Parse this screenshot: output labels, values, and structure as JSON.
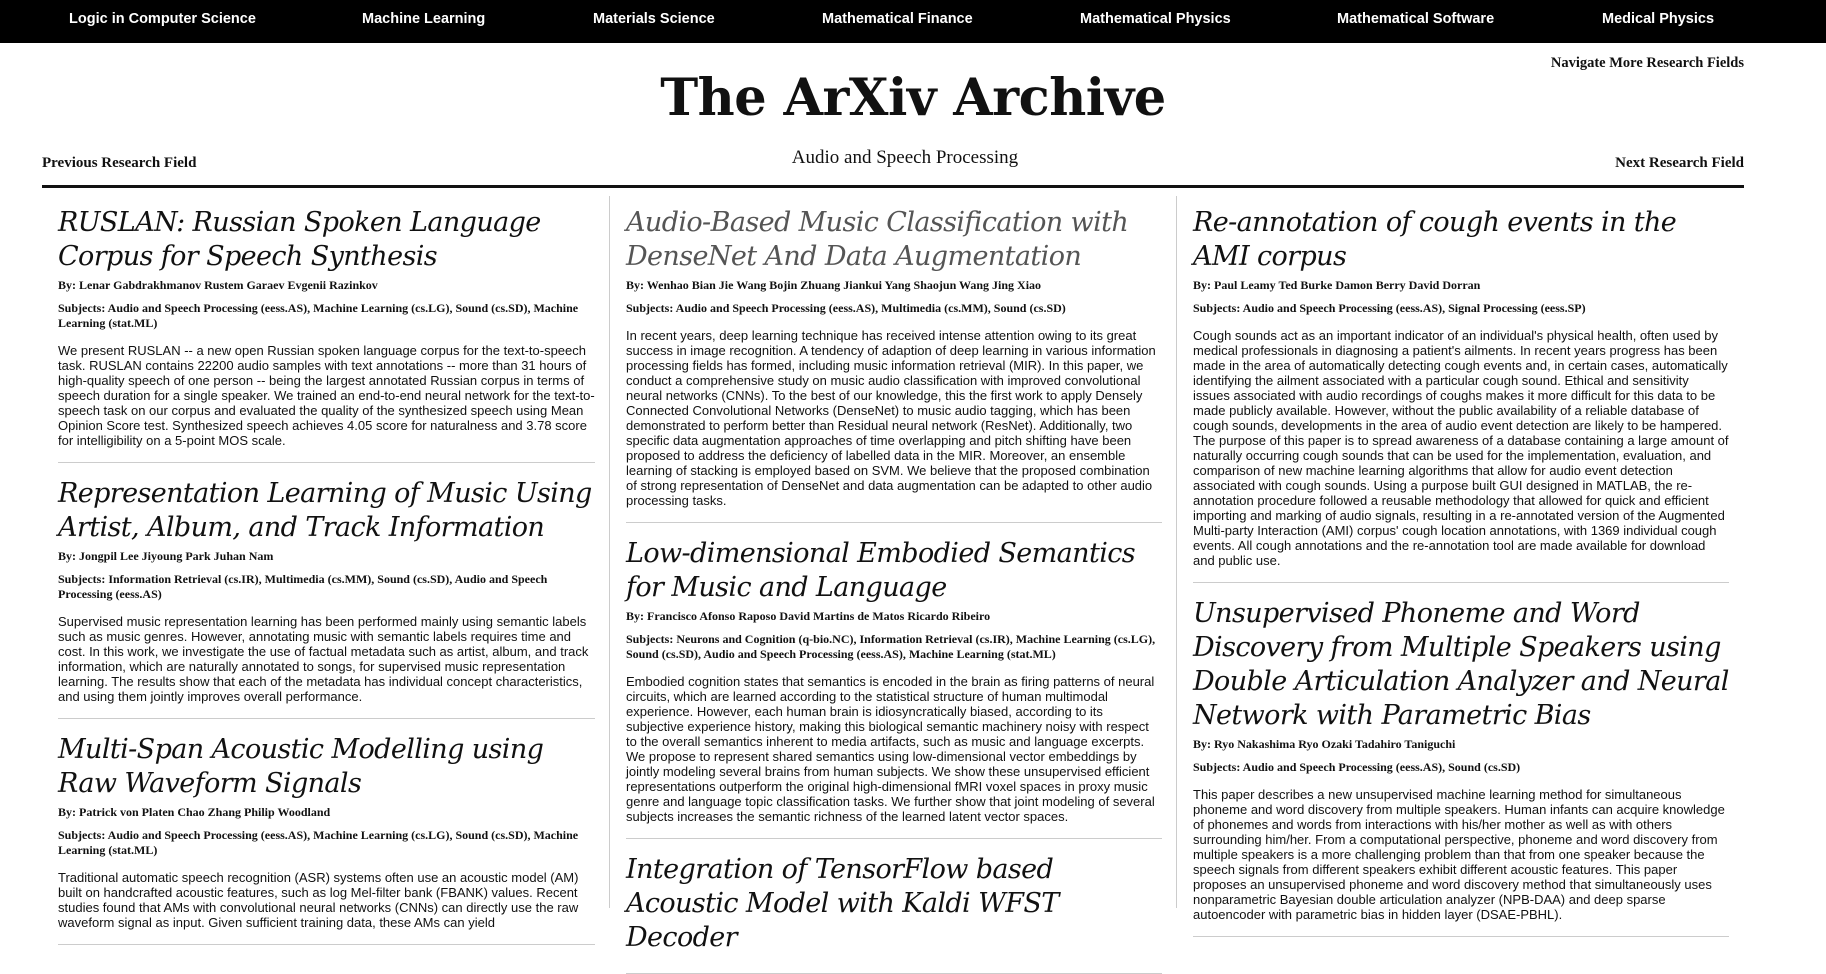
{
  "topnav": [
    {
      "label": "Logic in Computer Science"
    },
    {
      "label": "Machine Learning"
    },
    {
      "label": "Materials Science"
    },
    {
      "label": "Mathematical Finance"
    },
    {
      "label": "Mathematical Physics"
    },
    {
      "label": "Mathematical Software"
    },
    {
      "label": "Medical Physics"
    }
  ],
  "header": {
    "nav_more": "Navigate More Research Fields",
    "site_title": "The ArXiv Archive",
    "field_name": "Audio and Speech Processing",
    "prev_field": "Previous Research Field",
    "next_field": "Next Research Field"
  },
  "columns": [
    [
      {
        "title": "RUSLAN: Russian Spoken Language Corpus for Speech Synthesis",
        "authors": "By: Lenar Gabdrakhmanov Rustem Garaev Evgenii Razinkov",
        "subjects": "Subjects: Audio and Speech Processing (eess.AS), Machine Learning (cs.LG), Sound (cs.SD), Machine Learning (stat.ML)",
        "abstract": "We present RUSLAN -- a new open Russian spoken language corpus for the text-to-speech task. RUSLAN contains 22200 audio samples with text annotations -- more than 31 hours of high-quality speech of one person -- being the largest annotated Russian corpus in terms of speech duration for a single speaker. We trained an end-to-end neural network for the text-to-speech task on our corpus and evaluated the quality of the synthesized speech using Mean Opinion Score test. Synthesized speech achieves 4.05 score for naturalness and 3.78 score for intelligibility on a 5-point MOS scale."
      },
      {
        "title": "Representation Learning of Music Using Artist, Album, and Track Information",
        "authors": "By: Jongpil Lee Jiyoung Park Juhan Nam",
        "subjects": "Subjects: Information Retrieval (cs.IR), Multimedia (cs.MM), Sound (cs.SD), Audio and Speech Processing (eess.AS)",
        "abstract": "Supervised music representation learning has been performed mainly using semantic labels such as music genres. However, annotating music with semantic labels requires time and cost. In this work, we investigate the use of factual metadata such as artist, album, and track information, which are naturally annotated to songs, for supervised music representation learning. The results show that each of the metadata has individual concept characteristics, and using them jointly improves overall performance."
      },
      {
        "title": "Multi-Span Acoustic Modelling using Raw Waveform Signals",
        "authors": "By: Patrick von Platen Chao Zhang Philip Woodland",
        "subjects": "Subjects: Audio and Speech Processing (eess.AS), Machine Learning (cs.LG), Sound (cs.SD), Machine Learning (stat.ML)",
        "abstract": "Traditional automatic speech recognition (ASR) systems often use an acoustic model (AM) built on handcrafted acoustic features, such as log Mel-filter bank (FBANK) values. Recent studies found that AMs with convolutional neural networks (CNNs) can directly use the raw waveform signal as input. Given sufficient training data, these AMs can yield"
      }
    ],
    [
      {
        "title": "Audio-Based Music Classification with DenseNet And Data Augmentation",
        "faded": true,
        "authors": "By: Wenhao Bian Jie Wang Bojin Zhuang Jiankui Yang Shaojun Wang Jing Xiao",
        "subjects": "Subjects: Audio and Speech Processing (eess.AS), Multimedia (cs.MM), Sound (cs.SD)",
        "abstract": "In recent years, deep learning technique has received intense attention owing to its great success in image recognition. A tendency of adaption of deep learning in various information processing fields has formed, including music information retrieval (MIR). In this paper, we conduct a comprehensive study on music audio classification with improved convolutional neural networks (CNNs). To the best of our knowledge, this the first work to apply Densely Connected Convolutional Networks (DenseNet) to music audio tagging, which has been demonstrated to perform better than Residual neural network (ResNet). Additionally, two specific data augmentation approaches of time overlapping and pitch shifting have been proposed to address the deficiency of labelled data in the MIR. Moreover, an ensemble learning of stacking is employed based on SVM. We believe that the proposed combination of strong representation of DenseNet and data augmentation can be adapted to other audio processing tasks."
      },
      {
        "title": "Low-dimensional Embodied Semantics for Music and Language",
        "authors": "By: Francisco Afonso Raposo David Martins de Matos Ricardo Ribeiro",
        "subjects": "Subjects: Neurons and Cognition (q-bio.NC), Information Retrieval (cs.IR), Machine Learning (cs.LG), Sound (cs.SD), Audio and Speech Processing (eess.AS), Machine Learning (stat.ML)",
        "abstract": "Embodied cognition states that semantics is encoded in the brain as firing patterns of neural circuits, which are learned according to the statistical structure of human multimodal experience. However, each human brain is idiosyncratically biased, according to its subjective experience history, making this biological semantic machinery noisy with respect to the overall semantics inherent to media artifacts, such as music and language excerpts. We propose to represent shared semantics using low-dimensional vector embeddings by jointly modeling several brains from human subjects. We show these unsupervised efficient representations outperform the original high-dimensional fMRI voxel spaces in proxy music genre and language topic classification tasks. We further show that joint modeling of several subjects increases the semantic richness of the learned latent vector spaces."
      },
      {
        "title": "Integration of TensorFlow based Acoustic Model with Kaldi WFST Decoder",
        "authors": "",
        "subjects": "",
        "abstract": ""
      }
    ],
    [
      {
        "title": "Re-annotation of cough events in the AMI corpus",
        "authors": "By: Paul Leamy Ted Burke Damon Berry David Dorran",
        "subjects": "Subjects: Audio and Speech Processing (eess.AS), Signal Processing (eess.SP)",
        "abstract": "Cough sounds act as an important indicator of an individual's physical health, often used by medical professionals in diagnosing a patient's ailments. In recent years progress has been made in the area of automatically detecting cough events and, in certain cases, automatically identifying the ailment associated with a particular cough sound. Ethical and sensitivity issues associated with audio recordings of coughs makes it more difficult for this data to be made publicly available. However, without the public availability of a reliable database of cough sounds, developments in the area of audio event detection are likely to be hampered. The purpose of this paper is to spread awareness of a database containing a large amount of naturally occurring cough sounds that can be used for the implementation, evaluation, and comparison of new machine learning algorithms that allow for audio event detection associated with cough sounds. Using a purpose built GUI designed in MATLAB, the re-annotation procedure followed a reusable methodology that allowed for quick and efficient importing and marking of audio signals, resulting in a re-annotated version of the Augmented Multi-party Interaction (AMI) corpus' cough location annotations, with 1369 individual cough events. All cough annotations and the re-annotation tool are made available for download and public use."
      },
      {
        "title": "Unsupervised Phoneme and Word Discovery from Multiple Speakers using Double Articulation Analyzer and Neural Network with Parametric Bias",
        "authors": "By: Ryo Nakashima Ryo Ozaki Tadahiro Taniguchi",
        "subjects": "Subjects: Audio and Speech Processing (eess.AS), Sound (cs.SD)",
        "abstract": "This paper describes a new unsupervised machine learning method for simultaneous phoneme and word discovery from multiple speakers. Human infants can acquire knowledge of phonemes and words from interactions with his/her mother as well as with others surrounding him/her. From a computational perspective, phoneme and word discovery from multiple speakers is a more challenging problem than that from one speaker because the speech signals from different speakers exhibit different acoustic features. This paper proposes an unsupervised phoneme and word discovery method that simultaneously uses nonparametric Bayesian double articulation analyzer (NPB-DAA) and deep sparse autoencoder with parametric bias in hidden layer (DSAE-PBHL)."
      }
    ]
  ]
}
